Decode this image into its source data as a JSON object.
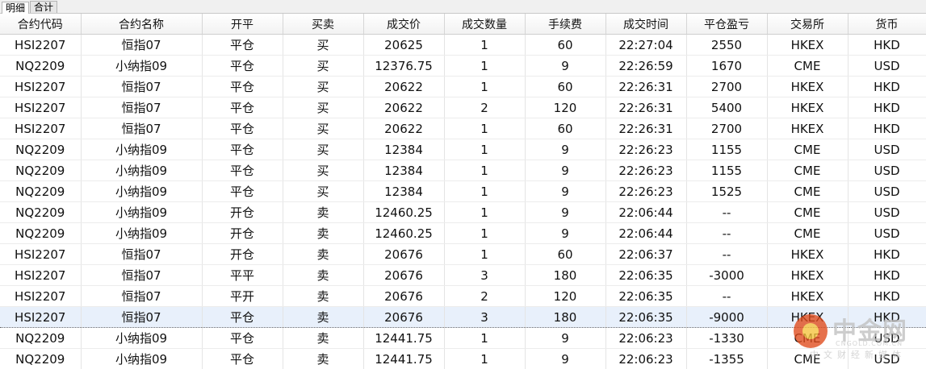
{
  "tabs": [
    {
      "label": "明细",
      "active": true
    },
    {
      "label": "合计",
      "active": false
    }
  ],
  "columns": [
    "合约代码",
    "合约名称",
    "开平",
    "买卖",
    "成交价",
    "成交数量",
    "手续费",
    "成交时间",
    "平仓盈亏",
    "交易所",
    "货币"
  ],
  "rows": [
    {
      "code": "HSI2207",
      "name": "恒指07",
      "offset": "平仓",
      "side": "买",
      "price": "20625",
      "qty": "1",
      "fee": "60",
      "time": "22:27:04",
      "pnl": "2550",
      "exchange": "HKEX",
      "currency": "HKD"
    },
    {
      "code": "NQ2209",
      "name": "小纳指09",
      "offset": "平仓",
      "side": "买",
      "price": "12376.75",
      "qty": "1",
      "fee": "9",
      "time": "22:26:59",
      "pnl": "1670",
      "exchange": "CME",
      "currency": "USD"
    },
    {
      "code": "HSI2207",
      "name": "恒指07",
      "offset": "平仓",
      "side": "买",
      "price": "20622",
      "qty": "1",
      "fee": "60",
      "time": "22:26:31",
      "pnl": "2700",
      "exchange": "HKEX",
      "currency": "HKD"
    },
    {
      "code": "HSI2207",
      "name": "恒指07",
      "offset": "平仓",
      "side": "买",
      "price": "20622",
      "qty": "2",
      "fee": "120",
      "time": "22:26:31",
      "pnl": "5400",
      "exchange": "HKEX",
      "currency": "HKD"
    },
    {
      "code": "HSI2207",
      "name": "恒指07",
      "offset": "平仓",
      "side": "买",
      "price": "20622",
      "qty": "1",
      "fee": "60",
      "time": "22:26:31",
      "pnl": "2700",
      "exchange": "HKEX",
      "currency": "HKD"
    },
    {
      "code": "NQ2209",
      "name": "小纳指09",
      "offset": "平仓",
      "side": "买",
      "price": "12384",
      "qty": "1",
      "fee": "9",
      "time": "22:26:23",
      "pnl": "1155",
      "exchange": "CME",
      "currency": "USD"
    },
    {
      "code": "NQ2209",
      "name": "小纳指09",
      "offset": "平仓",
      "side": "买",
      "price": "12384",
      "qty": "1",
      "fee": "9",
      "time": "22:26:23",
      "pnl": "1155",
      "exchange": "CME",
      "currency": "USD"
    },
    {
      "code": "NQ2209",
      "name": "小纳指09",
      "offset": "平仓",
      "side": "买",
      "price": "12384",
      "qty": "1",
      "fee": "9",
      "time": "22:26:23",
      "pnl": "1525",
      "exchange": "CME",
      "currency": "USD"
    },
    {
      "code": "NQ2209",
      "name": "小纳指09",
      "offset": "开仓",
      "side": "卖",
      "price": "12460.25",
      "qty": "1",
      "fee": "9",
      "time": "22:06:44",
      "pnl": "--",
      "exchange": "CME",
      "currency": "USD"
    },
    {
      "code": "NQ2209",
      "name": "小纳指09",
      "offset": "开仓",
      "side": "卖",
      "price": "12460.25",
      "qty": "1",
      "fee": "9",
      "time": "22:06:44",
      "pnl": "--",
      "exchange": "CME",
      "currency": "USD"
    },
    {
      "code": "HSI2207",
      "name": "恒指07",
      "offset": "开仓",
      "side": "卖",
      "price": "20676",
      "qty": "1",
      "fee": "60",
      "time": "22:06:37",
      "pnl": "--",
      "exchange": "HKEX",
      "currency": "HKD"
    },
    {
      "code": "HSI2207",
      "name": "恒指07",
      "offset": "平平",
      "side": "卖",
      "price": "20676",
      "qty": "3",
      "fee": "180",
      "time": "22:06:35",
      "pnl": "-3000",
      "exchange": "HKEX",
      "currency": "HKD"
    },
    {
      "code": "HSI2207",
      "name": "恒指07",
      "offset": "平开",
      "side": "卖",
      "price": "20676",
      "qty": "2",
      "fee": "120",
      "time": "22:06:35",
      "pnl": "--",
      "exchange": "HKEX",
      "currency": "HKD"
    },
    {
      "code": "HSI2207",
      "name": "恒指07",
      "offset": "平仓",
      "side": "卖",
      "price": "20676",
      "qty": "3",
      "fee": "180",
      "time": "22:06:35",
      "pnl": "-9000",
      "exchange": "HKEX",
      "currency": "HKD",
      "selected": true
    },
    {
      "code": "NQ2209",
      "name": "小纳指09",
      "offset": "平仓",
      "side": "卖",
      "price": "12441.75",
      "qty": "1",
      "fee": "9",
      "time": "22:06:23",
      "pnl": "-1330",
      "exchange": "CME",
      "currency": "USD"
    },
    {
      "code": "NQ2209",
      "name": "小纳指09",
      "offset": "平仓",
      "side": "卖",
      "price": "12441.75",
      "qty": "1",
      "fee": "9",
      "time": "22:06:23",
      "pnl": "-1355",
      "exchange": "CME",
      "currency": "USD"
    }
  ],
  "colors": {
    "open": "#7a4fa8",
    "close": "#d9b43a",
    "buy": "#d02020",
    "sell": "#1c8a1c",
    "profit": "#d02020",
    "loss": "#1c8a1c",
    "selected_row": "#e8f0fb"
  },
  "watermark": {
    "name": "中金网",
    "domain": "CNGOLD.COM.CN",
    "slogan": "中文财经新媒体"
  }
}
